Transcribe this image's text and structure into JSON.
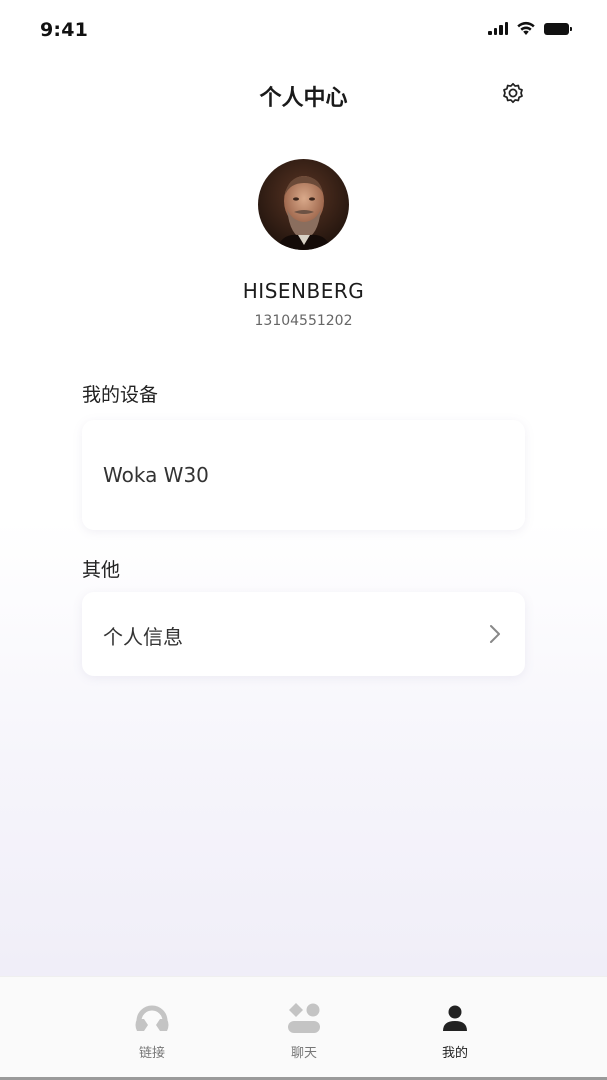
{
  "status_bar": {
    "time": "9:41",
    "icons": [
      "signal-icon",
      "wifi-icon",
      "battery-icon"
    ]
  },
  "header": {
    "title": "个人中心",
    "settings_icon": "gear-icon"
  },
  "profile": {
    "name": "HISENBERG",
    "phone": "13104551202"
  },
  "devices_section": {
    "title": "我的设备",
    "items": [
      {
        "name": "Woka W30"
      }
    ]
  },
  "other_section": {
    "title": "其他",
    "items": [
      {
        "label": "个人信息",
        "icon": "chevron-right-icon"
      }
    ]
  },
  "tab_bar": {
    "tabs": [
      {
        "label": "链接",
        "icon": "headphones-icon",
        "active": false
      },
      {
        "label": "聊天",
        "icon": "chat-icon",
        "active": false
      },
      {
        "label": "我的",
        "icon": "person-icon",
        "active": true
      }
    ]
  },
  "colors": {
    "active_tab": "#222222",
    "inactive_tab": "#c4c4c4",
    "background_tint": "#f0eef8"
  }
}
